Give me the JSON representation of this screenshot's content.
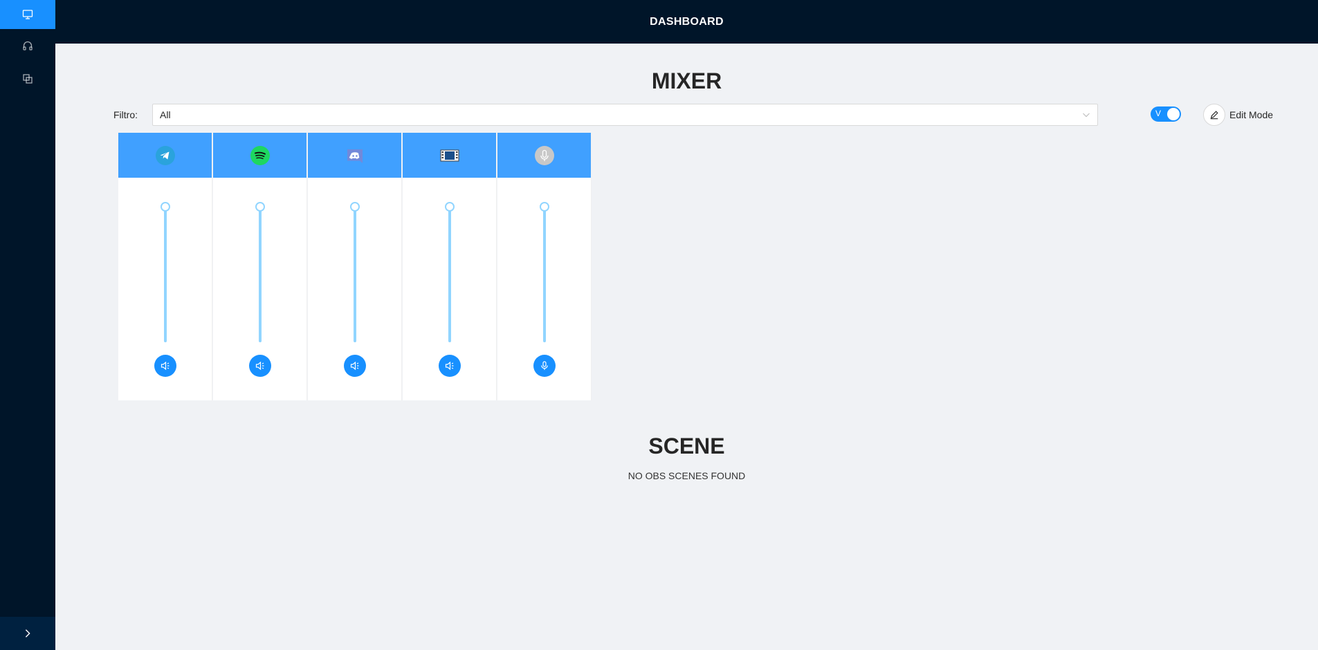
{
  "header": {
    "title": "DASHBOARD"
  },
  "sidebar": {
    "items": [
      {
        "icon": "desktop-icon",
        "active": true
      },
      {
        "icon": "headphones-icon",
        "active": false
      },
      {
        "icon": "block-icon",
        "active": false
      }
    ],
    "collapse_icon": "chevron-right-icon"
  },
  "mixer": {
    "title": "MIXER",
    "filter": {
      "label": "Filtro:",
      "value": "All"
    },
    "toggle": {
      "label": "V",
      "on": true
    },
    "edit_mode": {
      "label": "Edit Mode"
    },
    "channels": [
      {
        "app": "telegram",
        "icon": "telegram-icon",
        "button_icon": "sound-icon",
        "volume": 1.0
      },
      {
        "app": "spotify",
        "icon": "spotify-icon",
        "button_icon": "sound-icon",
        "volume": 1.0
      },
      {
        "app": "discord",
        "icon": "discord-icon",
        "button_icon": "sound-icon",
        "volume": 1.0
      },
      {
        "app": "media",
        "icon": "film-icon",
        "button_icon": "sound-icon",
        "volume": 1.0
      },
      {
        "app": "microphone",
        "icon": "microphone-icon",
        "button_icon": "microphone-icon",
        "volume": 1.0
      }
    ]
  },
  "scene": {
    "title": "SCENE",
    "empty_text": "NO OBS SCENES FOUND"
  },
  "colors": {
    "sidebar_bg": "#001529",
    "accent": "#1890ff",
    "channel_header": "#40a0ff",
    "slider_track": "#91d5ff",
    "page_bg": "#f0f2f5"
  }
}
